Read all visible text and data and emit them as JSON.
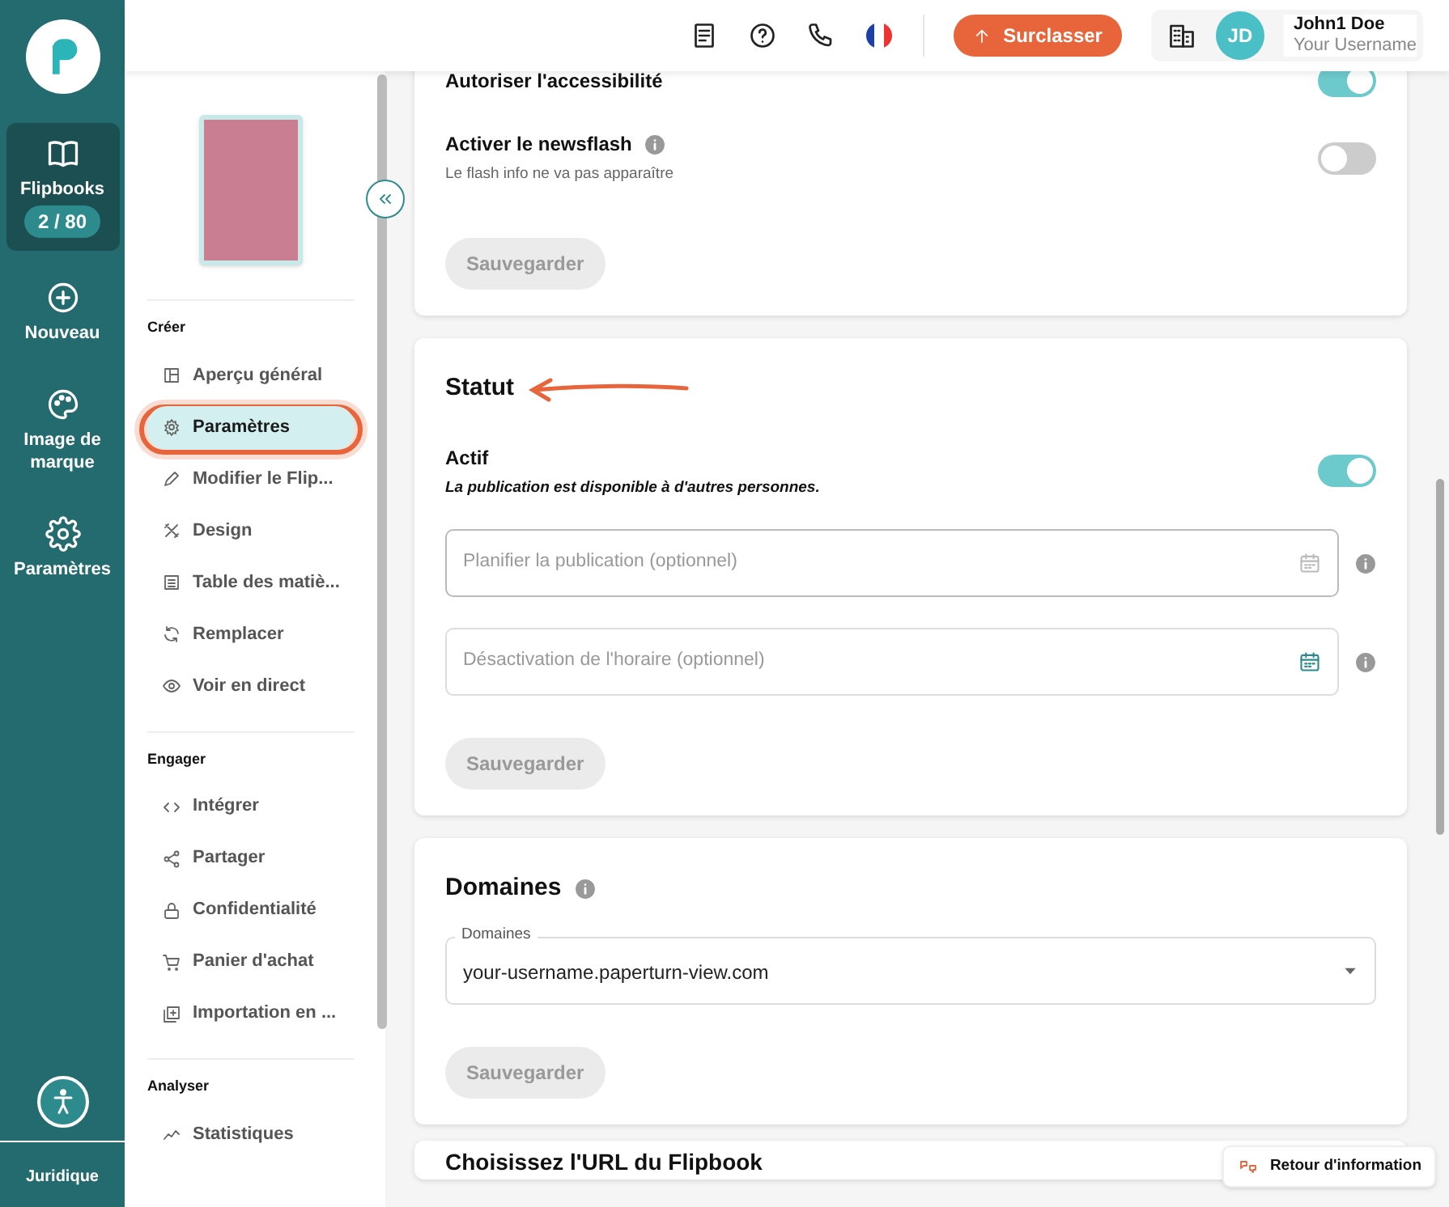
{
  "rail": {
    "items": [
      {
        "label": "Flipbooks",
        "badge": "2 / 80",
        "selected": true
      },
      {
        "label": "Nouveau",
        "selected": false
      },
      {
        "label": "Image de marque",
        "selected": false
      },
      {
        "label": "Paramètres",
        "selected": false
      }
    ],
    "footer": "Juridique"
  },
  "header": {
    "upgrade": "Surclasser",
    "user_name": "John1 Doe",
    "username": "Your Username",
    "initials": "JD"
  },
  "sidebar": {
    "sections": [
      {
        "title": "Créer",
        "items": [
          {
            "label": "Aperçu général",
            "selected": false
          },
          {
            "label": "Paramètres",
            "selected": true
          },
          {
            "label": "Modifier le Flip...",
            "selected": false
          },
          {
            "label": "Design",
            "selected": false
          },
          {
            "label": "Table des matiè...",
            "selected": false
          },
          {
            "label": "Remplacer",
            "selected": false
          },
          {
            "label": "Voir en direct",
            "selected": false
          }
        ]
      },
      {
        "title": "Engager",
        "items": [
          {
            "label": "Intégrer",
            "selected": false
          },
          {
            "label": "Partager",
            "selected": false
          },
          {
            "label": "Confidentialité",
            "selected": false
          },
          {
            "label": "Panier d'achat",
            "selected": false
          },
          {
            "label": "Importation en ...",
            "selected": false
          }
        ]
      },
      {
        "title": "Analyser",
        "items": [
          {
            "label": "Statistiques",
            "selected": false
          }
        ]
      }
    ]
  },
  "cards": [
    {
      "toggles": [
        {
          "label": "Autoriser l'accessibilité",
          "on": true
        },
        {
          "label": "Activer le newsflash",
          "info": true,
          "description": "Le flash info ne va pas apparaître",
          "on": false
        }
      ],
      "save": "Sauvegarder"
    },
    {
      "title": "Statut",
      "toggles": [
        {
          "label": "Actif",
          "description": "La publication est disponible à d'autres personnes.",
          "on": true
        }
      ],
      "fields": [
        {
          "placeholder": "Planifier la publication (optionnel)"
        },
        {
          "placeholder": "Désactivation de l'horaire (optionnel)"
        }
      ],
      "save": "Sauvegarder"
    },
    {
      "title": "Domaines",
      "info": true,
      "select": {
        "label": "Domaines",
        "value": "your-username.paperturn-view.com"
      },
      "save": "Sauvegarder"
    },
    {
      "title": "Choisissez l'URL du Flipbook"
    }
  ],
  "feedback": "Retour d'information"
}
